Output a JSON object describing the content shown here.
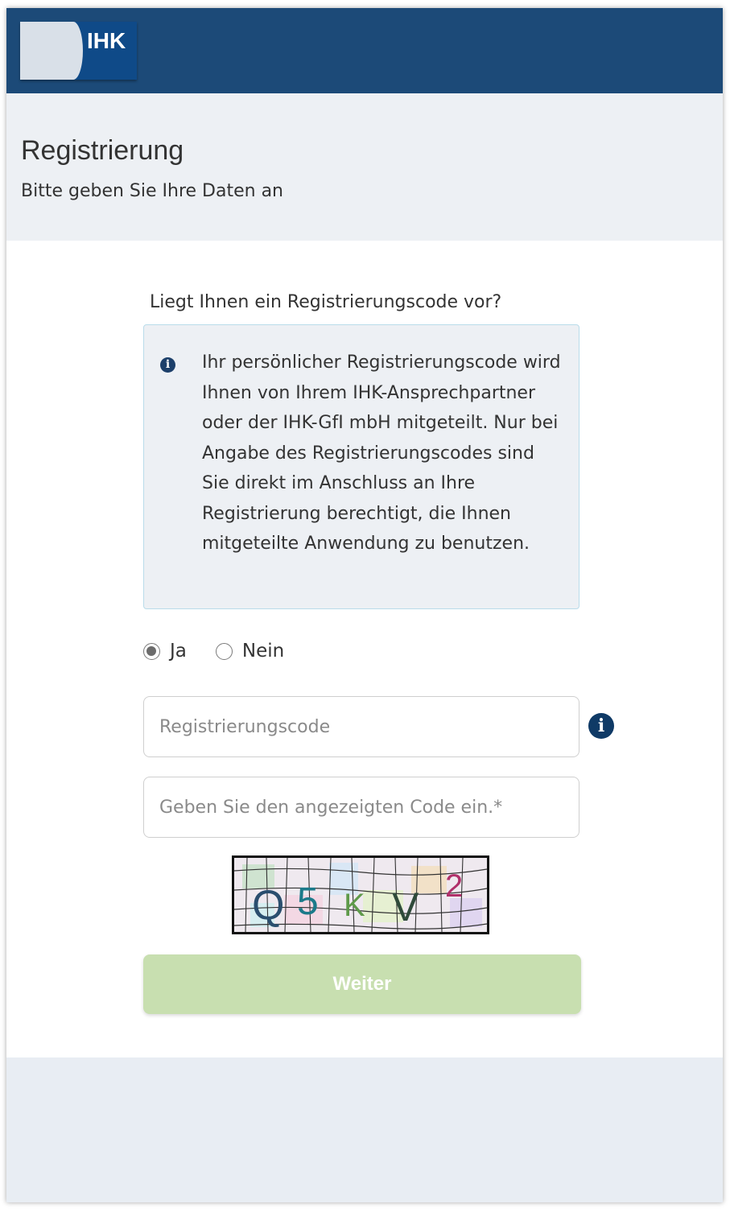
{
  "header": {
    "logo_text": "IHK",
    "title": "Registrierung",
    "subtitle": "Bitte geben Sie Ihre Daten an"
  },
  "form": {
    "question": "Liegt Ihnen ein Registrierungscode vor?",
    "info_text": "Ihr persönlicher Registrierungscode wird Ihnen von Ihrem IHK-Ansprechpartner oder der IHK-GfI mbH mitgeteilt. Nur bei Angabe des Registrierungscodes sind Sie direkt im Anschluss an Ihre Registrierung berechtigt, die Ihnen mitgeteilte Anwendung zu benutzen.",
    "radio_options": [
      {
        "label": "Ja",
        "checked": true
      },
      {
        "label": "Nein",
        "checked": false
      }
    ],
    "registration_code": {
      "value": "",
      "placeholder": "Registrierungscode"
    },
    "captcha_input": {
      "value": "",
      "placeholder": "Geben Sie den angezeigten Code ein.*"
    },
    "captcha_text": "Q5KV2",
    "submit_label": "Weiter"
  },
  "colors": {
    "topbar": "#1c4a78",
    "header_band": "#edf0f4",
    "info_border": "#b9dcea",
    "submit_disabled": "#c8dfb0"
  }
}
